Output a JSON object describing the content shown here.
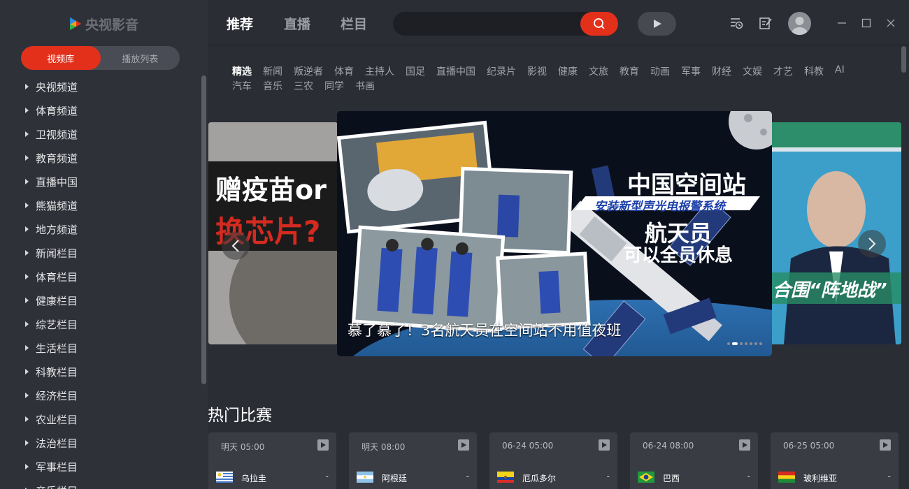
{
  "app": {
    "logo_text": "央视影音"
  },
  "sidebar": {
    "tabs": [
      {
        "label": "视频库",
        "active": true
      },
      {
        "label": "播放列表",
        "active": false
      }
    ],
    "items": [
      "央视频道",
      "体育频道",
      "卫视频道",
      "教育频道",
      "直播中国",
      "熊猫频道",
      "地方频道",
      "新闻栏目",
      "体育栏目",
      "健康栏目",
      "综艺栏目",
      "生活栏目",
      "科教栏目",
      "经济栏目",
      "农业栏目",
      "法治栏目",
      "军事栏目",
      "音乐栏目"
    ]
  },
  "topnav": {
    "tabs": [
      {
        "label": "推荐",
        "active": true
      },
      {
        "label": "直播",
        "active": false
      },
      {
        "label": "栏目",
        "active": false
      }
    ],
    "search_placeholder": ""
  },
  "categories": {
    "row1": [
      "精选",
      "新闻",
      "叛逆者",
      "体育",
      "主持人",
      "国足",
      "直播中国",
      "纪录片",
      "影视",
      "健康",
      "文旅",
      "教育",
      "动画",
      "军事",
      "财经",
      "文娱",
      "才艺",
      "科教",
      "AI"
    ],
    "row2": [
      "汽车",
      "音乐",
      "三农",
      "同学",
      "书画"
    ],
    "active": "精选"
  },
  "carousel": {
    "left_card": {
      "line1": "赠疫苗or",
      "line2": "换芯片?"
    },
    "hero": {
      "caption": "慕了慕了！3名航天员在空间站不用值夜班",
      "art_title": "中国空间站",
      "art_banner": "安装新型声光电报警系统",
      "art_line1": "航天员",
      "art_line2": "可以全员休息",
      "dots_total": 7,
      "active_dot": 1
    },
    "right_card": {
      "text": "合围“阵地战”"
    }
  },
  "hot_matches": {
    "title": "热门比赛",
    "matches": [
      {
        "time": "明天 05:00",
        "team": "乌拉圭",
        "score": "-",
        "flag": "uruguay"
      },
      {
        "time": "明天 08:00",
        "team": "阿根廷",
        "score": "-",
        "flag": "argentina"
      },
      {
        "time": "06-24 05:00",
        "team": "厄瓜多尔",
        "score": "-",
        "flag": "ecuador"
      },
      {
        "time": "06-24 08:00",
        "team": "巴西",
        "score": "-",
        "flag": "brazil"
      },
      {
        "time": "06-25 05:00",
        "team": "玻利维亚",
        "score": "-",
        "flag": "bolivia"
      }
    ]
  },
  "colors": {
    "accent": "#e3301b",
    "background": "#2b2d35",
    "sidebar": "#2f3139"
  }
}
